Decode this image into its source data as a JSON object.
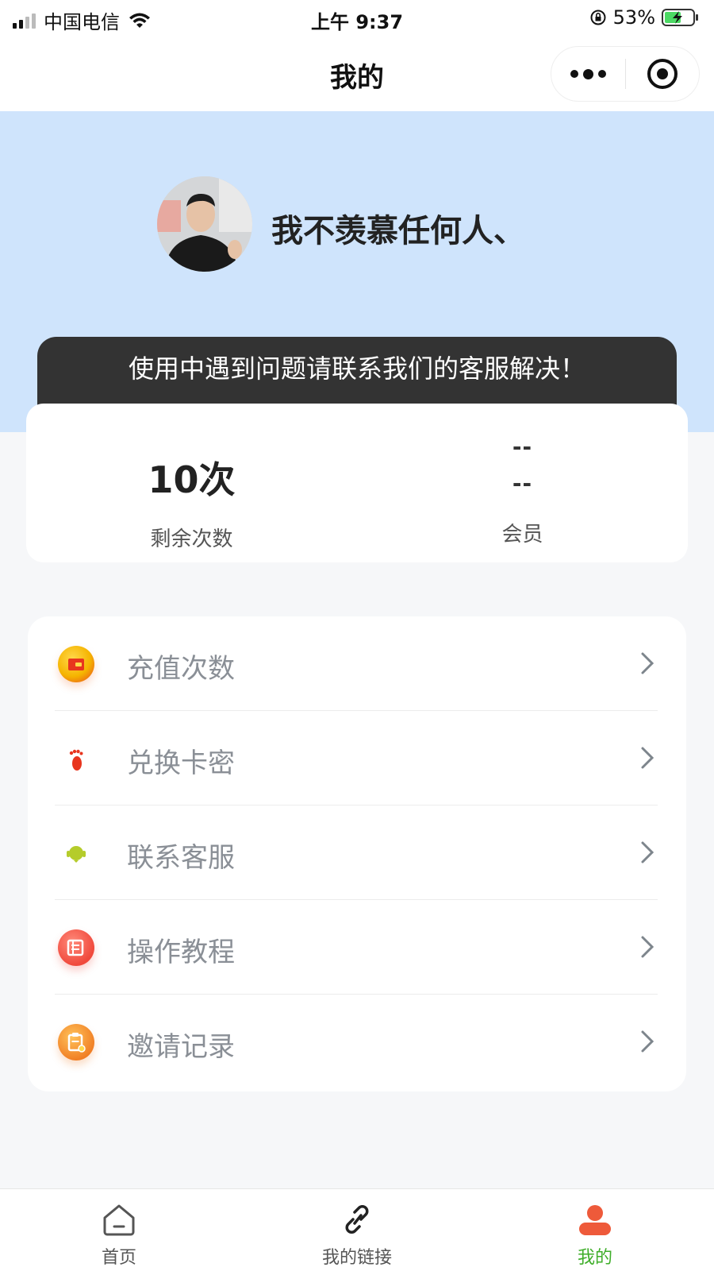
{
  "status_bar": {
    "carrier": "中国电信",
    "time": "上午 9:37",
    "battery": "53%"
  },
  "nav": {
    "title": "我的"
  },
  "profile": {
    "username": "我不羡慕任何人、"
  },
  "notice": {
    "text": "使用中遇到问题请联系我们的客服解决！"
  },
  "stats": {
    "remaining_value": "10次",
    "remaining_label": "剩余次数",
    "member_value_line1": "--",
    "member_value_line2": "--",
    "member_label": "会员"
  },
  "menu": {
    "items": [
      {
        "label": "充值次数",
        "icon": "wallet-icon"
      },
      {
        "label": "兑换卡密",
        "icon": "footprint-icon"
      },
      {
        "label": "联系客服",
        "icon": "headset-icon"
      },
      {
        "label": "操作教程",
        "icon": "guide-icon"
      },
      {
        "label": "邀请记录",
        "icon": "clipboard-icon"
      }
    ]
  },
  "tabbar": {
    "tabs": [
      {
        "label": "首页",
        "icon": "home-icon"
      },
      {
        "label": "我的链接",
        "icon": "link-icon"
      },
      {
        "label": "我的",
        "icon": "user-icon"
      }
    ],
    "active_color": "#3fae2a"
  },
  "colors": {
    "header_bg": "#cfe4fc",
    "notice_bg": "#333333",
    "page_bg": "#f6f7f9"
  }
}
